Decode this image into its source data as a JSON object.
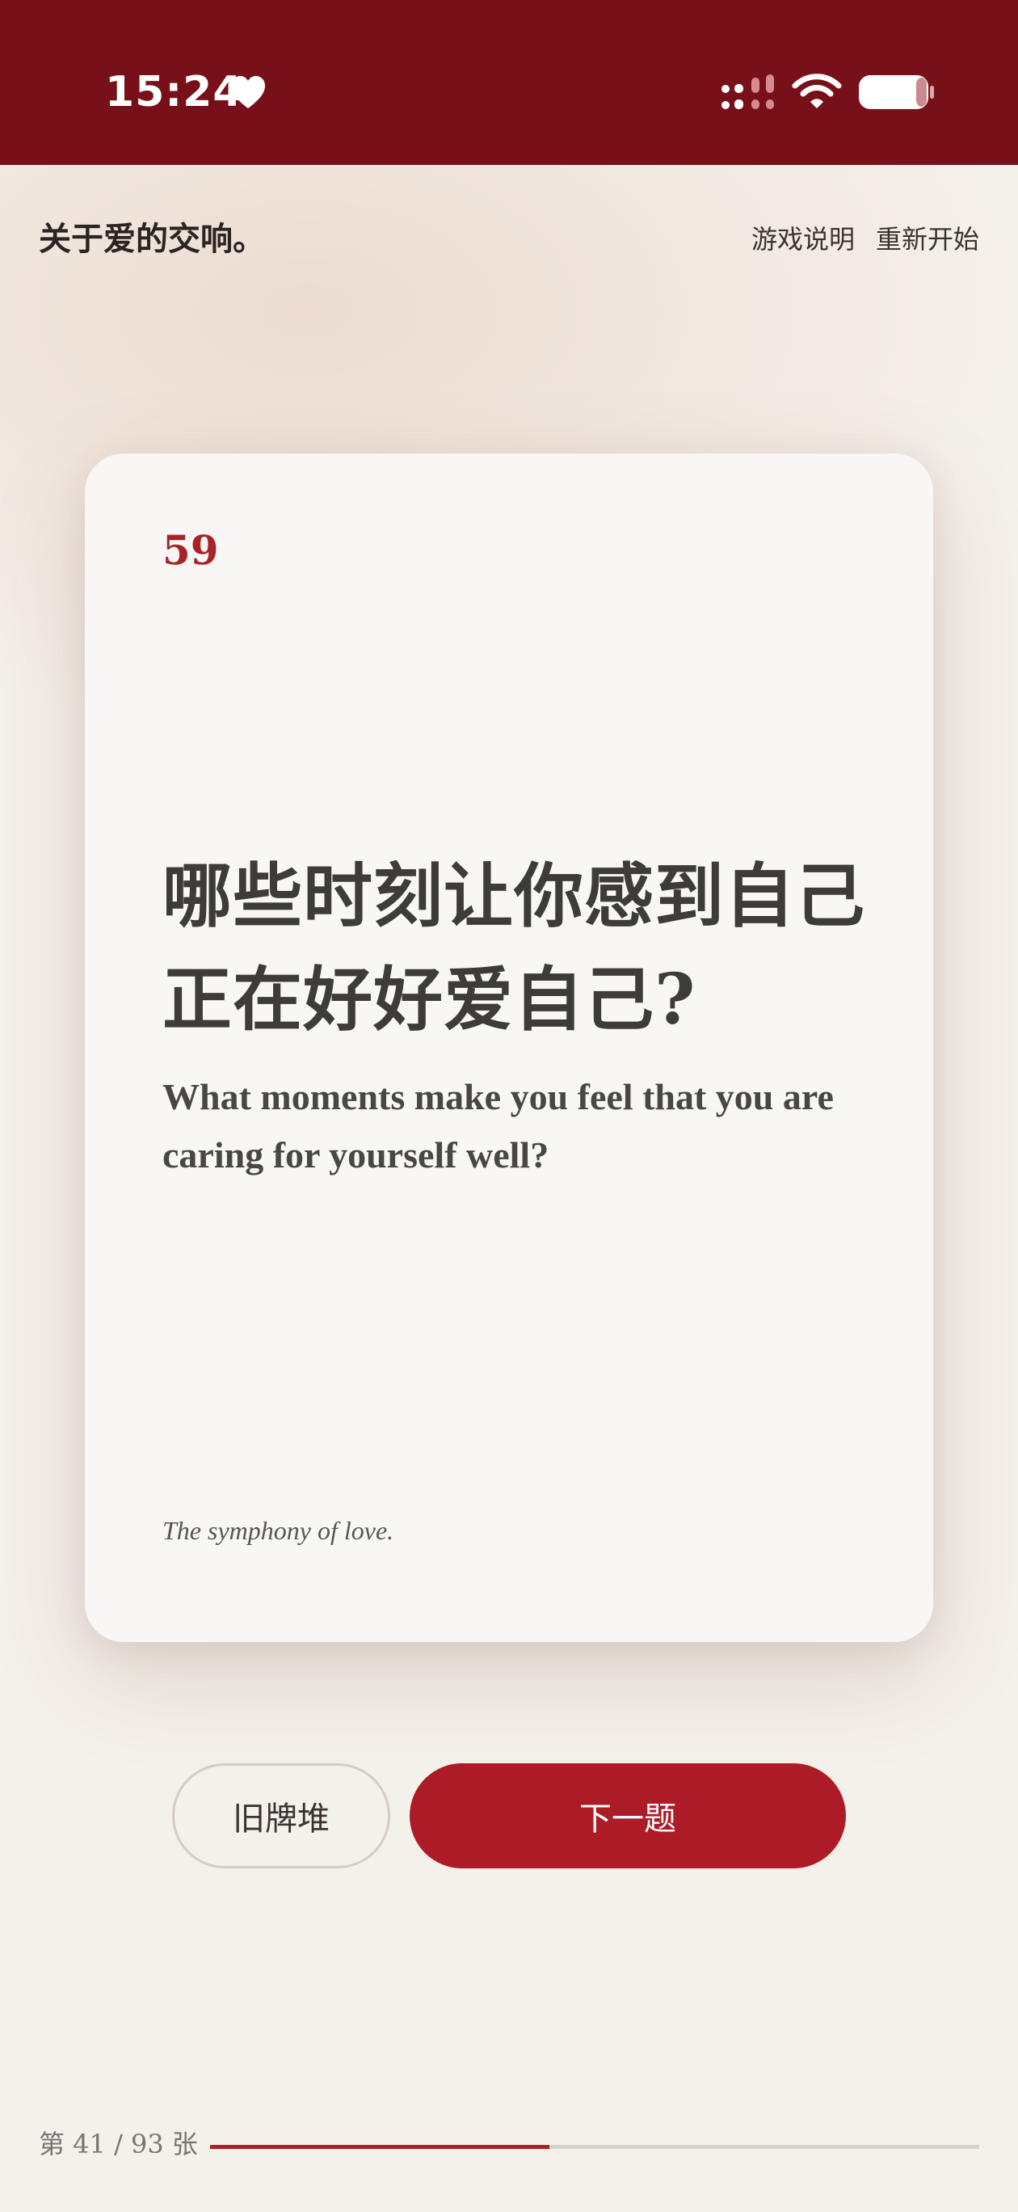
{
  "status_bar": {
    "time": "15:24",
    "icons": [
      "heart-icon",
      "signal-icon",
      "wifi-icon",
      "battery-icon"
    ],
    "background": "#78101a"
  },
  "header": {
    "app_title": "关于爱的交响。",
    "links": [
      {
        "label": "游戏说明"
      },
      {
        "label": "重新开始"
      }
    ]
  },
  "card": {
    "number": "59",
    "question_cn": "哪些时刻让你感到自己正在好好爱自己?",
    "question_en": "What moments make you feel that you are caring for yourself well?",
    "footer": "The symphony of love."
  },
  "actions": {
    "old_deck_label": "旧牌堆",
    "next_label": "下一题"
  },
  "progress": {
    "label": "第 41 / 93 张",
    "current": 41,
    "total": 93
  },
  "colors": {
    "accent": "#ac1b26",
    "number": "#a82328",
    "page_bg": "#f4f0ea",
    "card_bg": "#f8f7f5"
  }
}
